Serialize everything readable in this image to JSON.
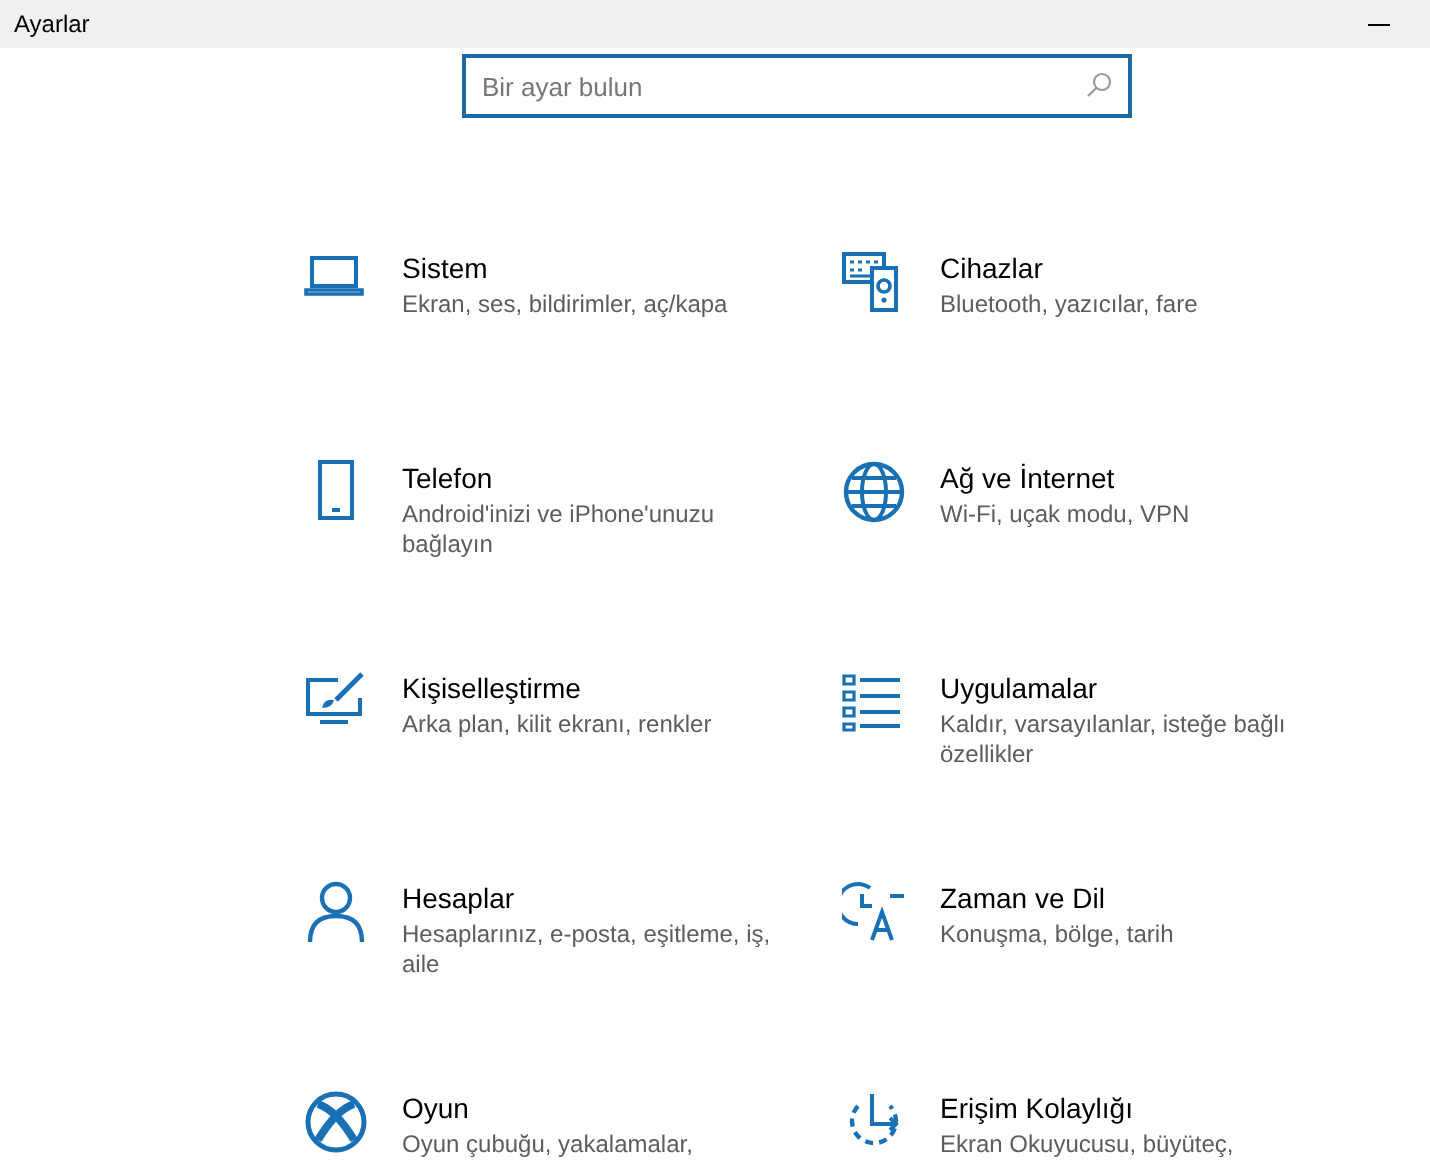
{
  "window": {
    "title": "Ayarlar"
  },
  "search": {
    "placeholder": "Bir ayar bulun"
  },
  "categories": [
    {
      "title": "Sistem",
      "description": "Ekran, ses, bildirimler, aç/kapa"
    },
    {
      "title": "Cihazlar",
      "description": "Bluetooth, yazıcılar, fare"
    },
    {
      "title": "Telefon",
      "description": "Android'inizi ve iPhone'unuzu bağlayın"
    },
    {
      "title": "Ağ ve İnternet",
      "description": "Wi-Fi, uçak modu, VPN"
    },
    {
      "title": "Kişiselleştirme",
      "description": "Arka plan, kilit ekranı, renkler"
    },
    {
      "title": "Uygulamalar",
      "description": "Kaldır, varsayılanlar, isteğe bağlı özellikler"
    },
    {
      "title": "Hesaplar",
      "description": "Hesaplarınız, e-posta, eşitleme, iş, aile"
    },
    {
      "title": "Zaman ve Dil",
      "description": "Konuşma, bölge, tarih"
    },
    {
      "title": "Oyun",
      "description": "Oyun çubuğu, yakalamalar,"
    },
    {
      "title": "Erişim Kolaylığı",
      "description": "Ekran Okuyucusu, büyüteç,"
    }
  ]
}
